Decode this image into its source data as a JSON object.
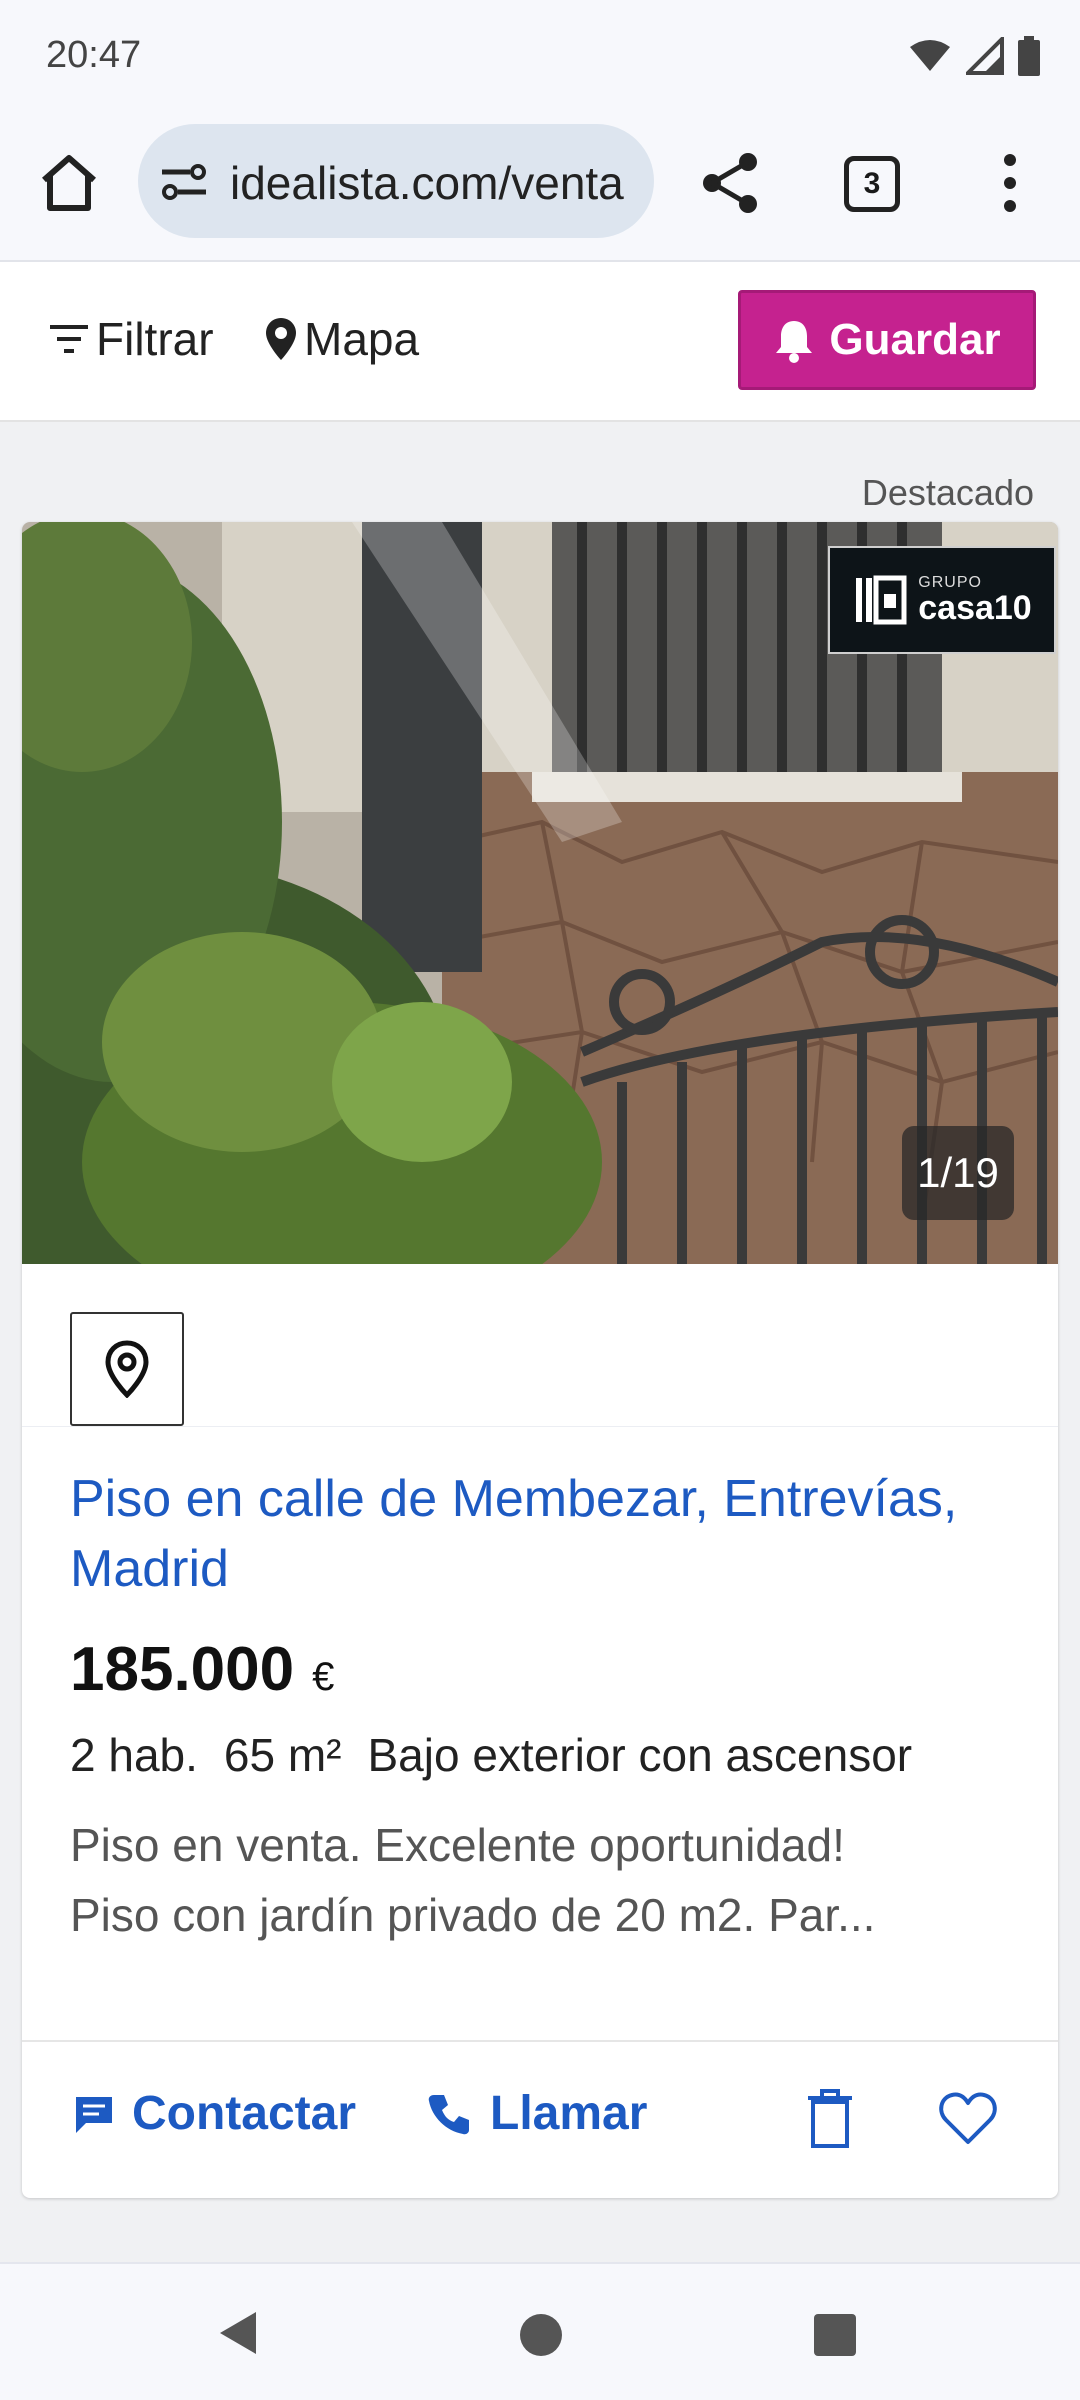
{
  "status_bar": {
    "time": "20:47",
    "icons": [
      "wifi-icon",
      "cell-signal-icon",
      "battery-icon"
    ]
  },
  "browser": {
    "url": "idealista.com/venta",
    "tab_count": "3",
    "icons": [
      "home-icon",
      "tune-icon",
      "share-icon",
      "more-vert-icon"
    ]
  },
  "toolbar": {
    "filter_label": "Filtrar",
    "map_label": "Mapa",
    "save_label": "Guardar",
    "save_color": "#c5228f"
  },
  "listing": {
    "featured_label": "Destacado",
    "agency": {
      "small": "GRUPO",
      "big": "casa10"
    },
    "photo_counter": "1/19",
    "title": "Piso en calle de Membezar, Entrevías, Madrid",
    "price": "185.000",
    "currency": "€",
    "rooms": "2 hab.",
    "area": "65 m²",
    "floor": "Bajo exterior con ascensor",
    "description_line1": "Piso en venta. Excelente oportunidad!",
    "description_line2": "Piso con jardín privado de 20 m2. Par...",
    "link_color": "#1d5ac2",
    "actions": {
      "contact_label": "Contactar",
      "call_label": "Llamar"
    }
  }
}
